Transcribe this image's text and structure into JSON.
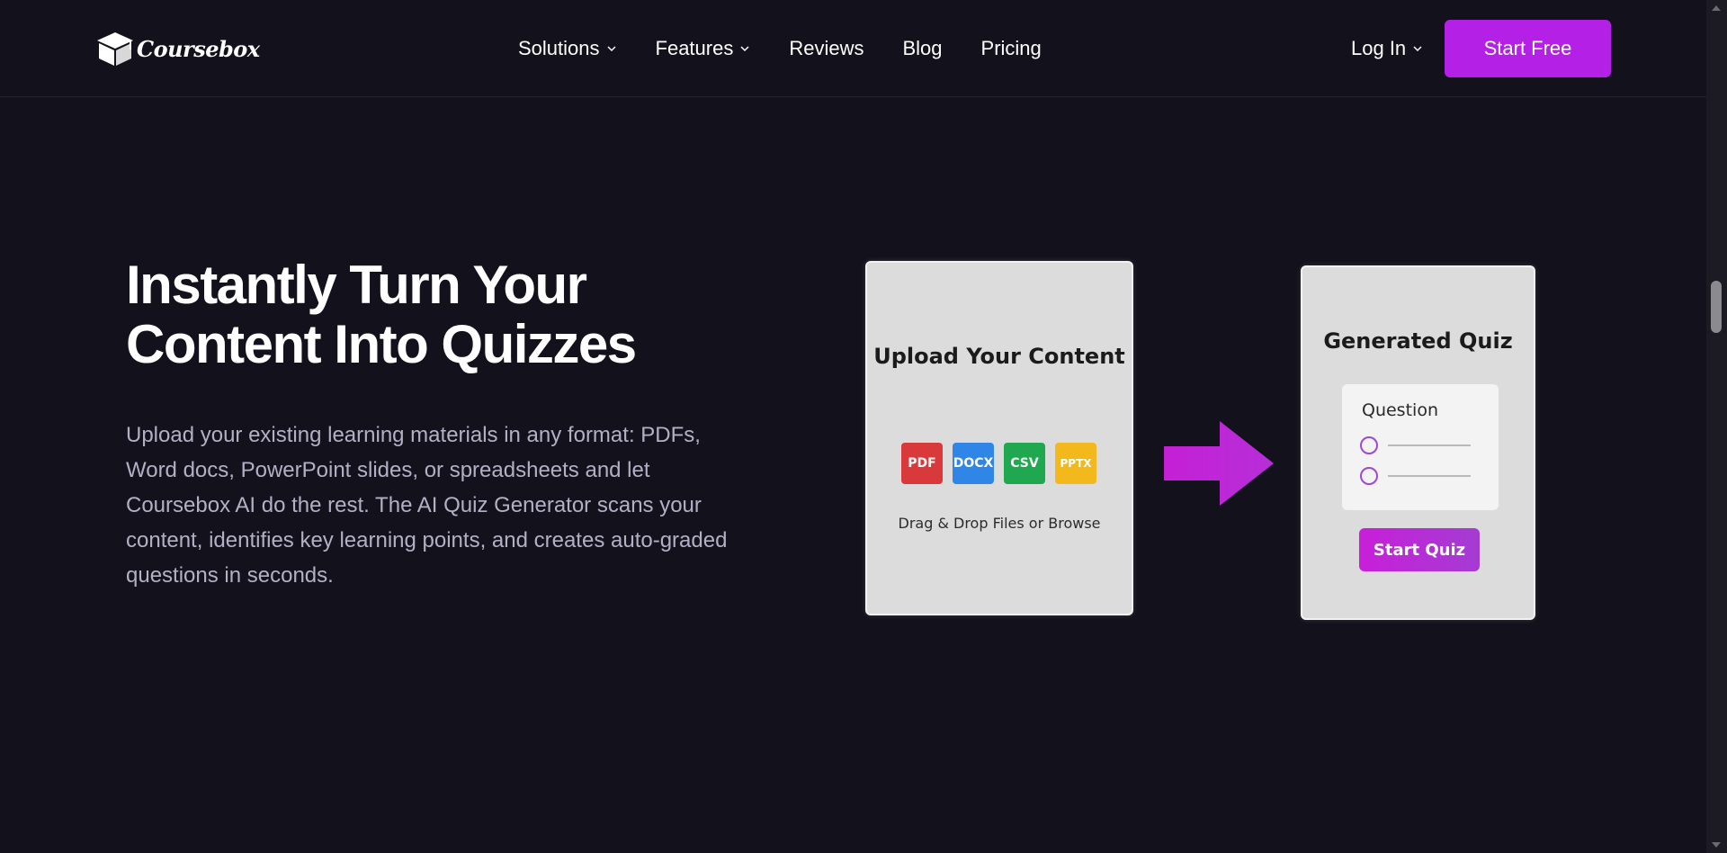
{
  "header": {
    "logo_text": "Coursebox",
    "nav": [
      {
        "label": "Solutions",
        "has_dropdown": true
      },
      {
        "label": "Features",
        "has_dropdown": true
      },
      {
        "label": "Reviews",
        "has_dropdown": false
      },
      {
        "label": "Blog",
        "has_dropdown": false
      },
      {
        "label": "Pricing",
        "has_dropdown": false
      }
    ],
    "login_label": "Log In",
    "cta_label": "Start Free"
  },
  "hero": {
    "title_line1": "Instantly Turn Your",
    "title_line2": "Content Into Quizzes",
    "body": "Upload your existing learning materials in any format: PDFs, Word docs, PowerPoint slides, or spreadsheets and let Coursebox AI do the rest. The AI Quiz Generator scans your content, identifies key learning points, and creates auto-graded questions in seconds."
  },
  "illustration": {
    "upload_title": "Upload Your Content",
    "file_types": [
      {
        "label": "PDF",
        "color": "#d9393b"
      },
      {
        "label": "DOCX",
        "color": "#2f86e6"
      },
      {
        "label": "CSV",
        "color": "#1fa84f"
      },
      {
        "label": "PPTX",
        "color": "#f3b81c"
      }
    ],
    "drag_text": "Drag & Drop Files or Browse",
    "quiz_title": "Generated Quiz",
    "question_label": "Question",
    "start_quiz_label": "Start Quiz"
  },
  "colors": {
    "background": "#13121c",
    "accent": "#b420e6",
    "arrow": "#c226d6"
  }
}
